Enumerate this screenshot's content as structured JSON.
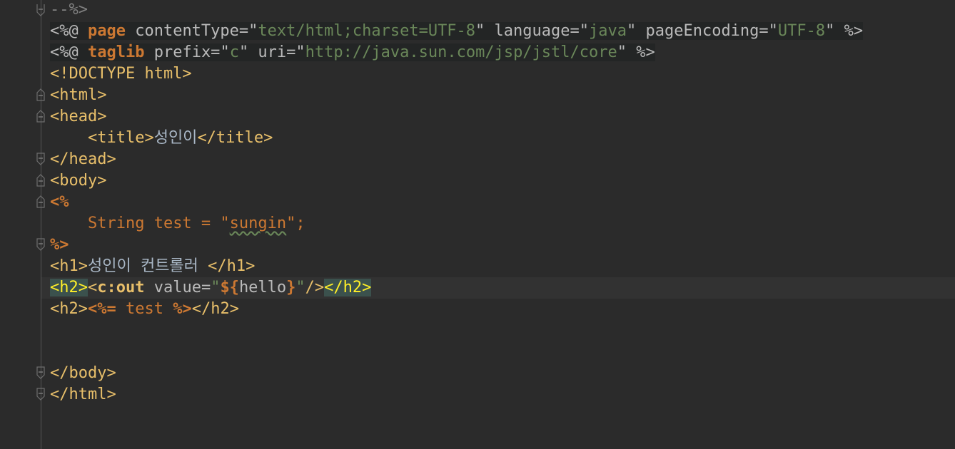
{
  "colors": {
    "background": "#2b2b2b",
    "tag": "#e8bf6a",
    "keyword": "#cc7832",
    "string": "#6a8759",
    "text": "#a9b7c6",
    "match_highlight": "#3b514d"
  },
  "lines": {
    "l0": "--%>",
    "l1": {
      "open": "<%@ ",
      "kw": "page",
      "a1": " contentType=",
      "q1": "\"",
      "v1": "text/html;charset=UTF-8",
      "q1b": "\"",
      "a2": " language=",
      "q2": "\"",
      "v2": "java",
      "q2b": "\"",
      "a3": " pageEncoding=",
      "q3": "\"",
      "v3": "UTF-8",
      "q3b": "\"",
      "close": " %>"
    },
    "l2": {
      "open": "<%@ ",
      "kw": "taglib",
      "a1": " prefix=",
      "q1": "\"",
      "v1": "c",
      "q1b": "\"",
      "a2": " uri=",
      "q2": "\"",
      "v2": "http://java.sun.com/jsp/jstl/core",
      "q2b": "\"",
      "close": " %>"
    },
    "l3": "<!DOCTYPE html>",
    "l4": "<html>",
    "l5": "<head>",
    "l6": {
      "indent": "    ",
      "open": "<title>",
      "text": "성인이",
      "close": "</title>"
    },
    "l7": "</head>",
    "l8": "<body>",
    "l9": "<%",
    "l10": {
      "indent": "    ",
      "code": "String test = ",
      "q": "\"",
      "str": "sungin",
      "qb": "\"",
      "end": ";"
    },
    "l11": "%>",
    "l12": {
      "open": "<h1>",
      "text": "성인이 컨트롤러 ",
      "close": "</h1>"
    },
    "l13": {
      "h2open": "<h2>",
      "lt": "<",
      "el": "c:out",
      "attr": " value=",
      "q": "\"",
      "expr_open": "${",
      "expr": "hello",
      "expr_close": "}",
      "qb": "\"",
      "selfclose": "/>",
      "h2close": "</h2>"
    },
    "l14": {
      "open": "<h2>",
      "jsp_open": "<%=",
      "code": " test ",
      "jsp_close": "%>",
      "close": "</h2>"
    },
    "l17": "</body>",
    "l18": "</html>"
  }
}
